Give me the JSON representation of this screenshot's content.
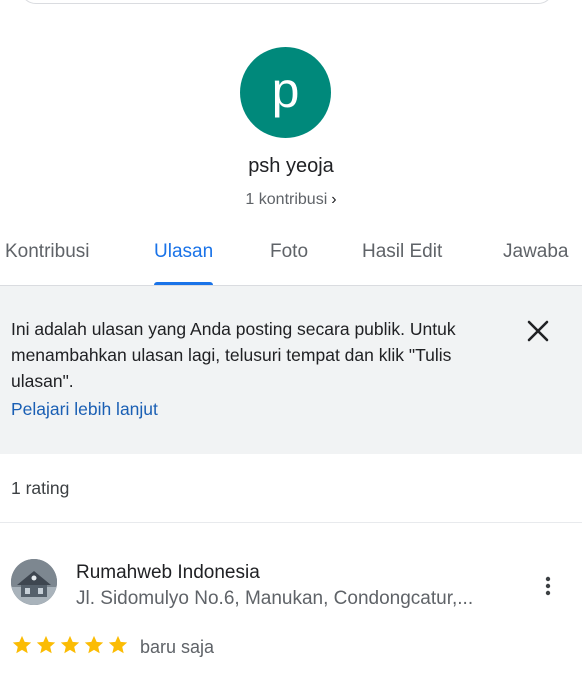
{
  "profile": {
    "initial": "p",
    "name": "psh yeoja",
    "contributions_label": "1 kontribusi",
    "avatar_color": "#00897b"
  },
  "tabs": [
    {
      "label": "Kontribusi",
      "active": false
    },
    {
      "label": "Ulasan",
      "active": true
    },
    {
      "label": "Foto",
      "active": false
    },
    {
      "label": "Hasil Edit",
      "active": false
    },
    {
      "label": "Jawaba",
      "active": false
    }
  ],
  "info": {
    "text": "Ini adalah ulasan yang Anda posting secara publik. Untuk menambahkan ulasan lagi, telusuri tempat dan klik \"Tulis ulasan\".",
    "link": "Pelajari lebih lanjut",
    "close_icon": "close-icon"
  },
  "reviews_summary": {
    "count_label": "1 rating"
  },
  "review": {
    "place_name": "Rumahweb Indonesia",
    "address": "Jl. Sidomulyo No.6, Manukan, Condongcatur,...",
    "rating": 5,
    "time": "baru saja",
    "star_color": "#fbbc04"
  },
  "colors": {
    "accent": "#1a73e8",
    "link": "#1a5fb4",
    "banner_bg": "#f1f3f4"
  }
}
